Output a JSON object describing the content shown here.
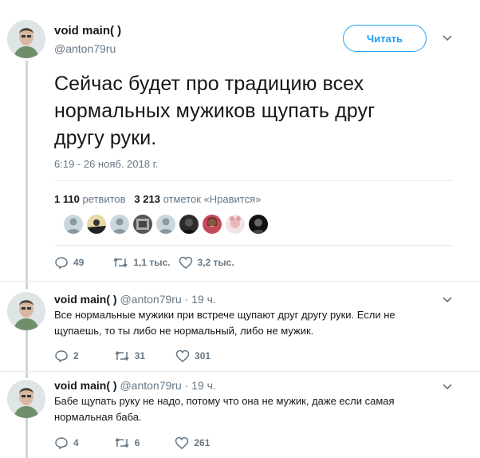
{
  "tweet": {
    "author_name": "void main( )",
    "author_handle": "@anton79ru",
    "follow_label": "Читать",
    "text": "Сейчас будет про традицию всех нормальных мужиков щупать друг другу руки.",
    "timestamp": "6:19 - 26 нояб. 2018 г.",
    "retweets_count": "1 110",
    "retweets_label": "ретвитов",
    "likes_count": "3 213",
    "likes_label": "отметок «Нравится»",
    "actions": {
      "replies": "49",
      "retweets": "1,1 тыс.",
      "likes": "3,2 тыс."
    }
  },
  "replies": [
    {
      "author_name": "void main( )",
      "author_handle": "@anton79ru",
      "time": "· 19 ч.",
      "text": "Все нормальные мужики при встрече щупают друг другу руки. Если не щупаешь, то ты либо не нормальный, либо не мужик.",
      "replies": "2",
      "retweets": "31",
      "likes": "301"
    },
    {
      "author_name": "void main( )",
      "author_handle": "@anton79ru",
      "time": "· 19 ч.",
      "text": "Бабе щупать руку не надо, потому что она не мужик, даже если самая нормальная баба.",
      "replies": "4",
      "retweets": "6",
      "likes": "261"
    }
  ],
  "colors": {
    "accent": "#1da1f2",
    "muted": "#657786",
    "divider": "#e6ecf0",
    "thread_line": "#ccd6dd"
  }
}
